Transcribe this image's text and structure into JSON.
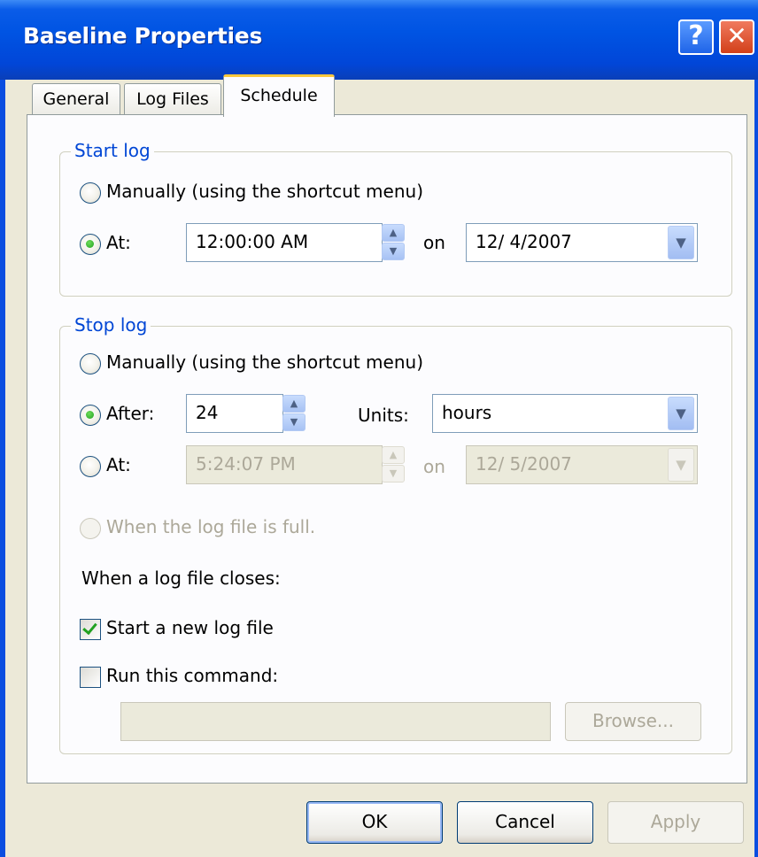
{
  "window": {
    "title": "Baseline Properties",
    "help_glyph": "?",
    "close_glyph": "✕"
  },
  "tabs": [
    {
      "label": "General"
    },
    {
      "label": "Log Files"
    },
    {
      "label": "Schedule",
      "selected": true
    }
  ],
  "start_log": {
    "group_label": "Start log",
    "manual_label": "Manually (using the shortcut menu)",
    "at_label": "At:",
    "time_value": "12:00:00 AM",
    "on_label": "on",
    "date_value": "12/  4/2007",
    "selected": "at"
  },
  "stop_log": {
    "group_label": "Stop log",
    "manual_label": "Manually (using the shortcut menu)",
    "after_label": "After:",
    "after_value": "24",
    "units_label": "Units:",
    "units_value": "hours",
    "at_label": "At:",
    "at_time_value": "5:24:07 PM",
    "on_label": "on",
    "at_date_value": "12/  5/2007",
    "full_label": "When the log file is full.",
    "closes_label": "When a log file closes:",
    "start_new_label": "Start a new log file",
    "start_new_checked": true,
    "run_command_label": "Run this command:",
    "run_command_checked": false,
    "command_value": "",
    "browse_label": "Browse...",
    "selected": "after"
  },
  "buttons": {
    "ok": "OK",
    "cancel": "Cancel",
    "apply": "Apply"
  },
  "colors": {
    "title_bar": "#0054e3",
    "group_label": "#0046d5",
    "tab_highlight": "#ffc83c",
    "radio_dot": "#21a121"
  }
}
